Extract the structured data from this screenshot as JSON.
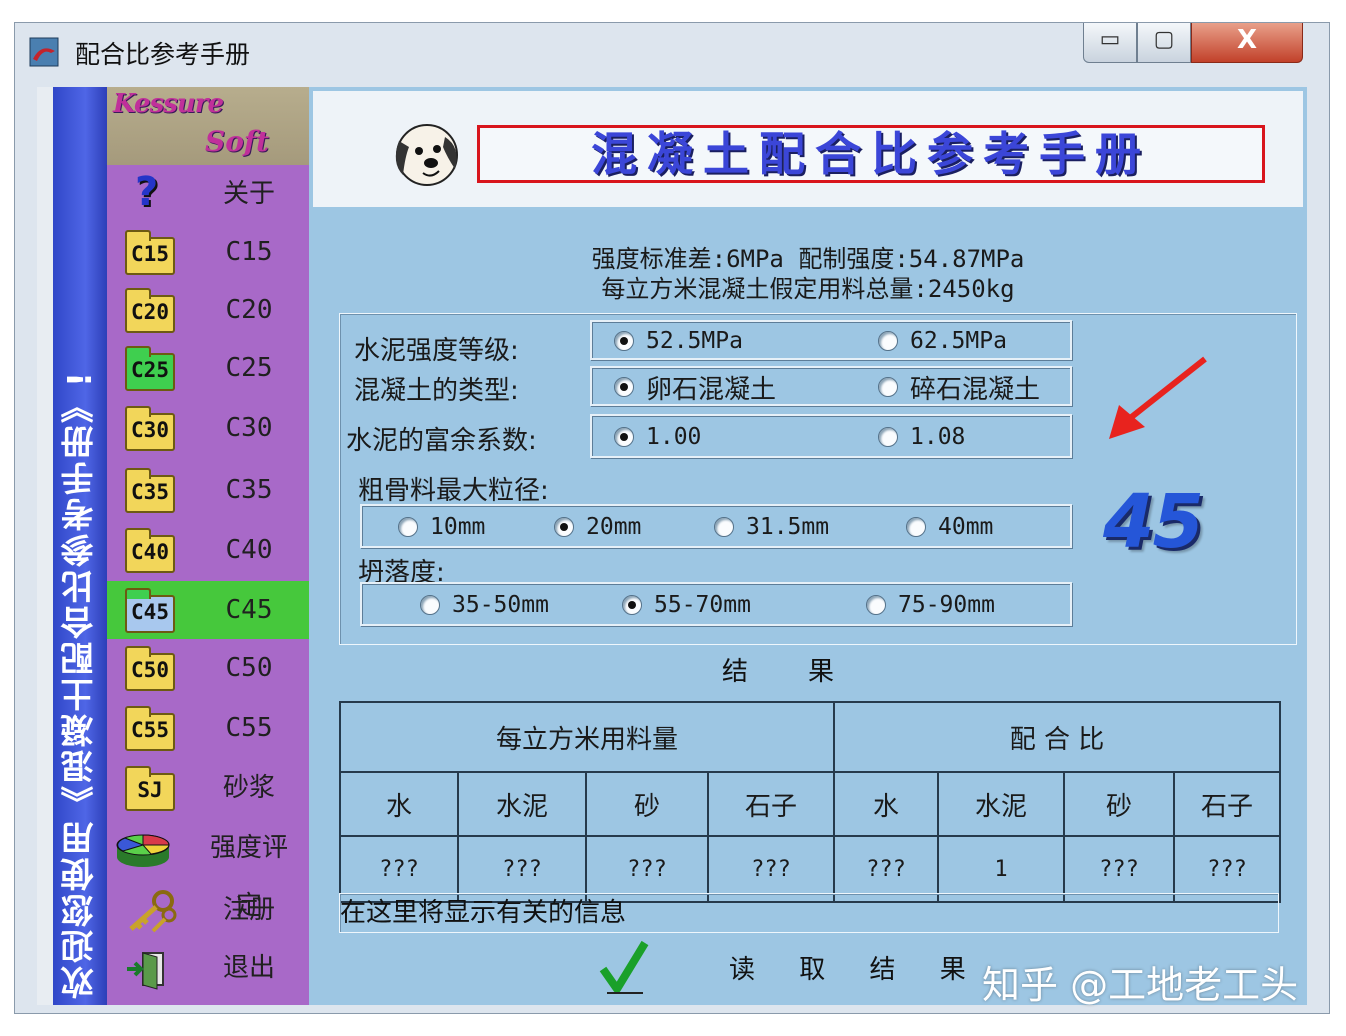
{
  "window": {
    "title": "配合比参考手册",
    "controls": {
      "minimize": "▭",
      "maximize": "▢",
      "close": "X"
    }
  },
  "vertical_banner": "欢迎您使用《混凝土配合比参考手册》!",
  "sidebar": {
    "logo_line1": "Kessure",
    "logo_line2": "Soft",
    "items": [
      {
        "icon": "question-icon",
        "badge": "?",
        "label": "关于"
      },
      {
        "icon": "folder-icon",
        "badge": "C15",
        "label": "C15"
      },
      {
        "icon": "folder-icon",
        "badge": "C20",
        "label": "C20"
      },
      {
        "icon": "folder-icon",
        "badge": "C25",
        "label": "C25"
      },
      {
        "icon": "folder-icon",
        "badge": "C30",
        "label": "C30"
      },
      {
        "icon": "folder-icon",
        "badge": "C35",
        "label": "C35"
      },
      {
        "icon": "folder-icon",
        "badge": "C40",
        "label": "C40"
      },
      {
        "icon": "folder-icon",
        "badge": "C45",
        "label": "C45",
        "selected": true
      },
      {
        "icon": "folder-icon",
        "badge": "C50",
        "label": "C50"
      },
      {
        "icon": "folder-icon",
        "badge": "C55",
        "label": "C55"
      },
      {
        "icon": "folder-icon",
        "badge": "SJ",
        "label": "砂浆"
      },
      {
        "icon": "pie-chart-icon",
        "label": "强度评定"
      },
      {
        "icon": "keys-icon",
        "label": "注册"
      },
      {
        "icon": "exit-icon",
        "label": "退出"
      }
    ]
  },
  "header": {
    "title": "混凝土配合比参考手册"
  },
  "info": {
    "line1": "强度标准差:6MPa 配制强度:54.87MPa",
    "line2": "每立方米混凝土假定用料总量:2450kg"
  },
  "form": {
    "cement_grade": {
      "label": "水泥强度等级:",
      "options": [
        "52.5MPa",
        "62.5MPa"
      ],
      "selected": 0
    },
    "concrete_type": {
      "label": "混凝土的类型:",
      "options": [
        "卵石混凝土",
        "碎石混凝土"
      ],
      "selected": 0
    },
    "surplus_factor": {
      "label": "水泥的富余系数:",
      "options": [
        "1.00",
        "1.08"
      ],
      "selected": 0
    },
    "aggregate_size": {
      "label": "粗骨料最大粒径:",
      "options": [
        "10mm",
        "20mm",
        "31.5mm",
        "40mm"
      ],
      "selected": 1
    },
    "slump": {
      "label": "坍落度:",
      "options": [
        "35-50mm",
        "55-70mm",
        "75-90mm"
      ],
      "selected": 1
    }
  },
  "grade_display": "45",
  "results": {
    "title": "结果",
    "group1": "每立方米用料量",
    "group2": "配 合 比",
    "columns": [
      "水",
      "水泥",
      "砂",
      "石子",
      "水",
      "水泥",
      "砂",
      "石子"
    ],
    "values": [
      "???",
      "???",
      "???",
      "???",
      "???",
      "1",
      "???",
      "???"
    ]
  },
  "message": "在这里将显示有关的信息",
  "read_button": "读 取 结 果",
  "watermark": "知乎 @工地老工头",
  "colors": {
    "sidebar": "#a869c8",
    "selected": "#46c83c",
    "main": "#9dc6e3",
    "banner": "#4f66e6",
    "title_border": "#d8141c"
  }
}
